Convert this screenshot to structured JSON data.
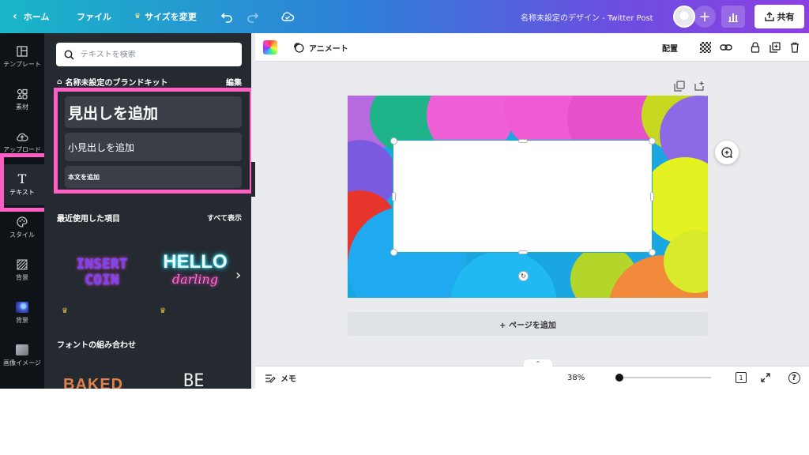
{
  "topbar": {
    "home_label": "ホーム",
    "file_label": "ファイル",
    "resize_label": "サイズを変更",
    "design_title": "名称未設定のデザイン - Twitter Post",
    "share_label": "共有"
  },
  "rail": {
    "items": [
      {
        "label": "テンプレート",
        "icon": "template-icon"
      },
      {
        "label": "素材",
        "icon": "elements-icon"
      },
      {
        "label": "アップロード",
        "icon": "upload-icon"
      },
      {
        "label": "テキスト",
        "icon": "text-icon"
      },
      {
        "label": "スタイル",
        "icon": "palette-icon"
      },
      {
        "label": "背景",
        "icon": "background-icon"
      },
      {
        "label": "背景",
        "icon": "background-image-icon"
      },
      {
        "label": "画像イメージ",
        "icon": "image-icon"
      }
    ]
  },
  "panel": {
    "search_placeholder": "テキストを検索",
    "brand_kit": "名称未設定のブランドキット",
    "edit_label": "編集",
    "add_heading": "見出しを追加",
    "add_subheading": "小見出しを追加",
    "add_body": "本文を追加",
    "recent_title": "最近使用した項目",
    "show_all": "すべて表示",
    "thumb1_line1": "INSERT",
    "thumb1_line2": "COIN",
    "thumb2_line1": "HELLO",
    "thumb2_line2": "darling",
    "font_combos_title": "フォントの組み合わせ",
    "font_thumb1": "BAKED",
    "font_thumb2": "BE"
  },
  "editor": {
    "animate_label": "アニメート",
    "layout_label": "配置",
    "add_page_label": "+ ページを追加",
    "memo_label": "メモ",
    "zoom_percent": "38%",
    "zoom_value": 0.03,
    "page_count": "1"
  },
  "colors": {
    "highlight": "#ff5ec4",
    "selection": "#14b3c4",
    "panel_bg": "#252a31",
    "rail_bg": "#0e1318"
  }
}
